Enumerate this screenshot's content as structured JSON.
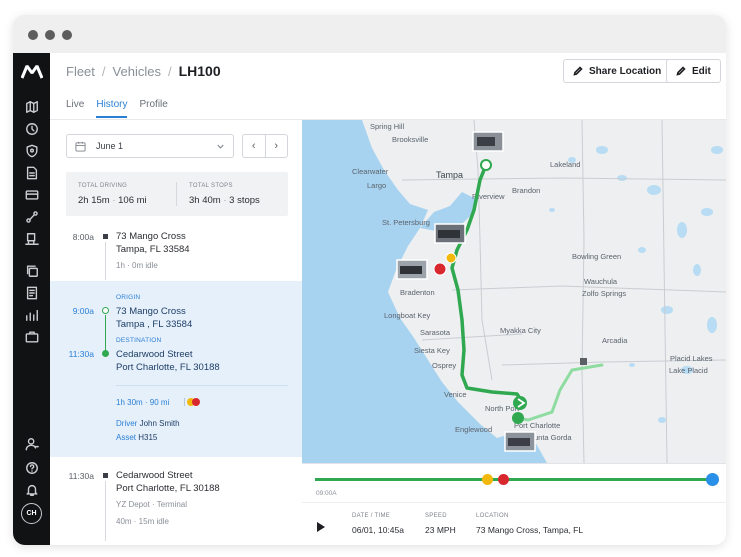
{
  "window": {
    "controls": [
      "close",
      "minimize",
      "maximize"
    ]
  },
  "brand": {
    "logo_icon": "m-logo-icon"
  },
  "sidebar": {
    "top_icons": [
      "map-icon",
      "clock-icon",
      "shield-icon",
      "document-icon",
      "card-icon",
      "route-icon",
      "truck-icon",
      "copy-icon",
      "file-icon",
      "chart-icon",
      "briefcase-icon"
    ],
    "bottom_icons": [
      "user-icon",
      "help-icon",
      "bell-icon"
    ],
    "avatar_initials": "CH"
  },
  "breadcrumb": {
    "items": [
      "Fleet",
      "Vehicles"
    ],
    "current": "LH100"
  },
  "actions": {
    "share_label": "Share Location",
    "edit_label": "Edit"
  },
  "tabs": [
    {
      "label": "Live",
      "active": false
    },
    {
      "label": "History",
      "active": true
    },
    {
      "label": "Profile",
      "active": false
    }
  ],
  "date_picker": {
    "value": "June 1",
    "prev_icon": "chevron-left-icon",
    "next_icon": "chevron-right-icon"
  },
  "summary": {
    "driving_label": "TOTAL DRIVING",
    "driving_time": "2h 15m",
    "driving_distance": "106 mi",
    "stops_label": "TOTAL STOPS",
    "stops_time": "3h 40m",
    "stops_count": "3 stops"
  },
  "timeline": {
    "stop1": {
      "time": "8:00a",
      "address_line1": "73 Mango Cross",
      "address_line2": "Tampa, FL 33584",
      "duration": "1h",
      "idle": "0m idle"
    },
    "trip": {
      "origin_label": "ORIGIN",
      "origin_time": "9:00a",
      "origin_line1": "73 Mango Cross",
      "origin_line2": "Tampa , FL 33584",
      "destination_label": "DESTINATION",
      "destination_time": "11:30a",
      "destination_line1": "Cedarwood Street",
      "destination_line2": "Port Charlotte, FL 30188",
      "duration": "1h 30m",
      "distance": "90 mi",
      "driver_label": "Driver",
      "driver_name": "John Smith",
      "asset_label": "Asset",
      "asset_name": "H315"
    },
    "stop2": {
      "time": "11:30a",
      "address_line1": "Cedarwood Street",
      "address_line2": "Port Charlotte, FL 30188",
      "depot": "YZ Depot",
      "type": "Terminal",
      "duration": "40m",
      "idle": "15m idle"
    }
  },
  "map": {
    "cities": [
      "Spring Hill",
      "Brooksville",
      "Clearwater",
      "Tampa",
      "Lakeland",
      "Largo",
      "Brandon",
      "Riverview",
      "St. Petersburg",
      "Bowling Green",
      "Wauchula",
      "Bradenton",
      "Zolfo Springs",
      "Longboat Key",
      "Sarasota",
      "Myakka City",
      "Arcadia",
      "Siesta Key",
      "Placid Lakes",
      "Osprey",
      "Lake Placid",
      "Venice",
      "North Port",
      "Englewood",
      "Port Charlotte",
      "Punta Gorda"
    ],
    "route_color": "#2fa84f",
    "route_light_color": "#8fdca0"
  },
  "scrubber": {
    "start_time": "09:00A",
    "progress": 0.99
  },
  "playback": {
    "play_icon": "play-icon",
    "datetime_label": "DATE / TIME",
    "datetime_value": "06/01, 10:45a",
    "speed_label": "SPEED",
    "speed_value": "23 MPH",
    "location_label": "LOCATION",
    "location_value": "73 Mango Cross, Tampa, FL"
  }
}
